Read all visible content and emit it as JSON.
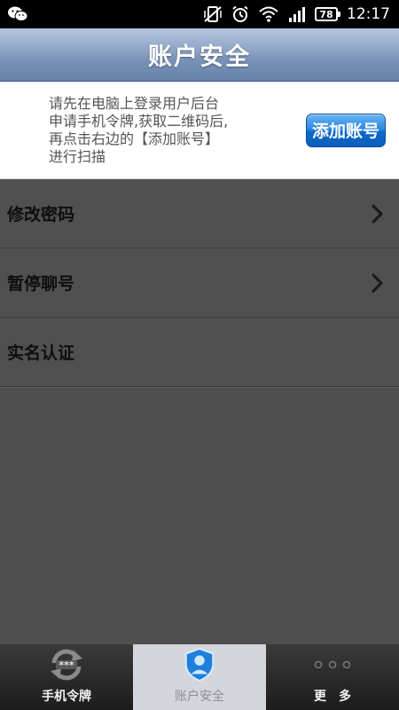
{
  "status_bar": {
    "time": "12:17",
    "battery": "78",
    "icons": [
      "wechat-icon",
      "vibrate-off-icon",
      "alarm-icon",
      "wifi-icon",
      "signal-icon",
      "battery-icon"
    ]
  },
  "header": {
    "title": "账户安全"
  },
  "info": {
    "text": "请先在电脑上登录用户后台\n申请手机令牌,获取二维码后,\n再点击右边的【添加账号】\n进行扫描",
    "add_button": "添加账号"
  },
  "menu": {
    "items": [
      {
        "label": "修改密码",
        "has_arrow": true
      },
      {
        "label": "暂停聊号",
        "has_arrow": true
      },
      {
        "label": "实名认证",
        "has_arrow": false
      }
    ]
  },
  "tabs": [
    {
      "label": "手机令牌",
      "icon": "token-refresh-icon",
      "active": false
    },
    {
      "label": "账户安全",
      "icon": "shield-icon",
      "active": true
    },
    {
      "label": "更多",
      "icon": "more-dots-icon",
      "active": false
    }
  ],
  "colors": {
    "title_gradient_top": "#b4c6de",
    "title_gradient_bottom": "#6683ab",
    "button_blue": "#1a78d8",
    "list_background": "#505050",
    "tab_active": "#d3d7dc"
  }
}
